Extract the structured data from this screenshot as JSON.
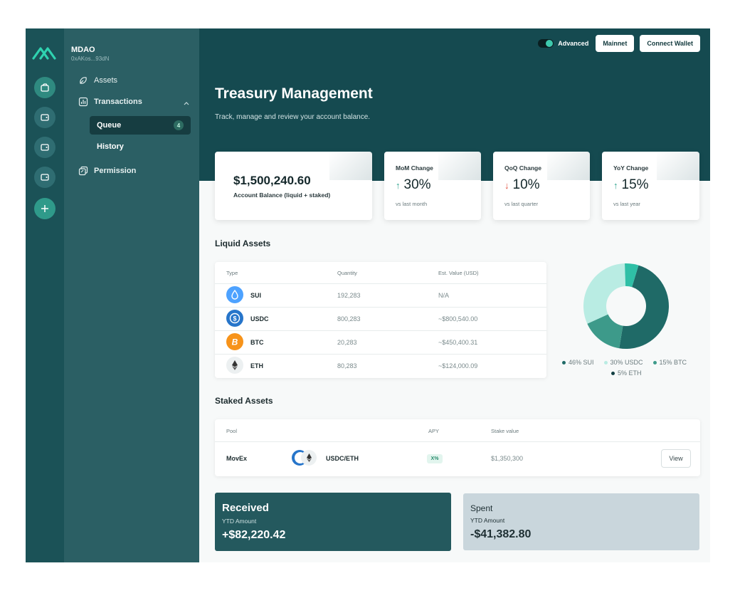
{
  "org": {
    "name": "MDAO",
    "address": "0xAKos...93dN"
  },
  "rail_icons": [
    "wallet-icon",
    "wallet-icon",
    "wallet-icon",
    "wallet-icon",
    "plus-icon"
  ],
  "nav": {
    "assets": "Assets",
    "transactions": "Transactions",
    "queue": "Queue",
    "queue_count": "4",
    "history": "History",
    "permission": "Permission"
  },
  "topbar": {
    "advanced_label": "Advanced",
    "advanced_on": true,
    "network": "Mainnet",
    "connect": "Connect Wallet"
  },
  "header": {
    "title": "Treasury Management",
    "subtitle": "Track, manage and review your account balance."
  },
  "balance": {
    "value": "$1,500,240.60",
    "label": "Account Balance (liquid + staked)"
  },
  "stats": [
    {
      "title": "MoM Change",
      "direction": "up",
      "arrow": "↑",
      "value": "30%",
      "foot": "vs last month"
    },
    {
      "title": "QoQ Change",
      "direction": "down",
      "arrow": "↓",
      "value": "10%",
      "foot": "vs last quarter"
    },
    {
      "title": "YoY Change",
      "direction": "up",
      "arrow": "↑",
      "value": "15%",
      "foot": "vs last year"
    }
  ],
  "liquid": {
    "title": "Liquid Assets",
    "headers": [
      "Type",
      "Quantity",
      "Est. Value (USD)"
    ],
    "rows": [
      {
        "name": "SUI",
        "quantity": "192,283",
        "value": "N/A",
        "icon": "water-drop-icon",
        "color": "#4da2ff"
      },
      {
        "name": "USDC",
        "quantity": "800,283",
        "value": "~$800,540.00",
        "icon": "dollar-icon",
        "color": "#2775ca"
      },
      {
        "name": "BTC",
        "quantity": "20,283",
        "value": "~$450,400.31",
        "icon": "bitcoin-icon",
        "color": "#f7931a"
      },
      {
        "name": "ETH",
        "quantity": "80,283",
        "value": "~$124,000.09",
        "icon": "ethereum-icon",
        "color": "#ecf0f1"
      }
    ],
    "legend": [
      {
        "label": "46% SUI",
        "color": "#1f6a67"
      },
      {
        "label": "30% USDC",
        "color": "#b9ece3"
      },
      {
        "label": "15% BTC",
        "color": "#3d9a8a"
      },
      {
        "label": "5% ETH",
        "color": "#123f42"
      }
    ]
  },
  "chart_data": {
    "type": "pie",
    "categories": [
      "SUI",
      "USDC",
      "BTC",
      "ETH"
    ],
    "values": [
      46,
      30,
      15,
      5
    ],
    "colors": [
      "#1f6a67",
      "#b9ece3",
      "#3d9a8a",
      "#2fbfa6"
    ]
  },
  "staked": {
    "title": "Staked Assets",
    "headers": [
      "Pool",
      "APY",
      "Stake value"
    ],
    "rows": [
      {
        "pool": "MovEx",
        "pair": "USDC/ETH",
        "apy": "X%",
        "stake": "$1,350,300",
        "action": "View"
      }
    ]
  },
  "flows": {
    "received": {
      "title": "Received",
      "label": "YTD Amount",
      "amount": "+$82,220.42"
    },
    "spent": {
      "title": "Spent",
      "label": "YTD Amount",
      "amount": "-$41,382.80"
    }
  },
  "colors": {
    "rail": "#1b5257",
    "sidebar": "#2b5f64",
    "hero": "#154a50",
    "accent": "#3ec9ad"
  }
}
